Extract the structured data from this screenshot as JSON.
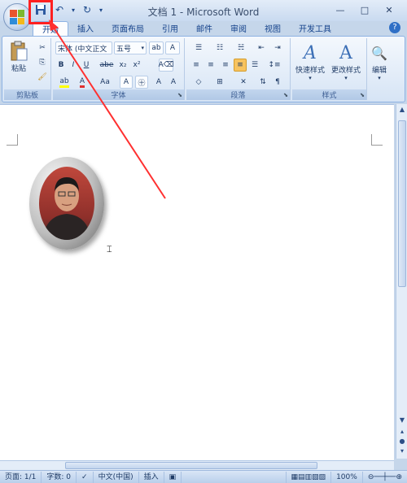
{
  "window": {
    "title": "文档 1 - Microsoft Word",
    "controls": [
      "—",
      "□",
      "✕"
    ]
  },
  "tabs": [
    "开始",
    "插入",
    "页面布局",
    "引用",
    "邮件",
    "审阅",
    "视图",
    "开发工具"
  ],
  "active_tab": "开始",
  "ribbon": {
    "clipboard": {
      "label": "剪贴板",
      "paste": "粘贴"
    },
    "font": {
      "label": "字体",
      "font_name": "宋体 (中文正文",
      "font_size": "五号",
      "buttons": [
        "B",
        "I",
        "U",
        "abe",
        "x₂",
        "x²",
        "Aa",
        "A",
        "A",
        "A"
      ]
    },
    "paragraph": {
      "label": "段落"
    },
    "styles": {
      "label": "样式",
      "quick_styles": "快速样式",
      "change_styles": "更改样式"
    },
    "editing": {
      "label": "编辑"
    }
  },
  "status": {
    "page": "页面: 1/1",
    "words": "字数: 0",
    "language": "中文(中国)",
    "insert": "插入",
    "zoom": "100%"
  },
  "colors": {
    "highlight_box": "#ff2020",
    "arrow": "#ff3030"
  }
}
